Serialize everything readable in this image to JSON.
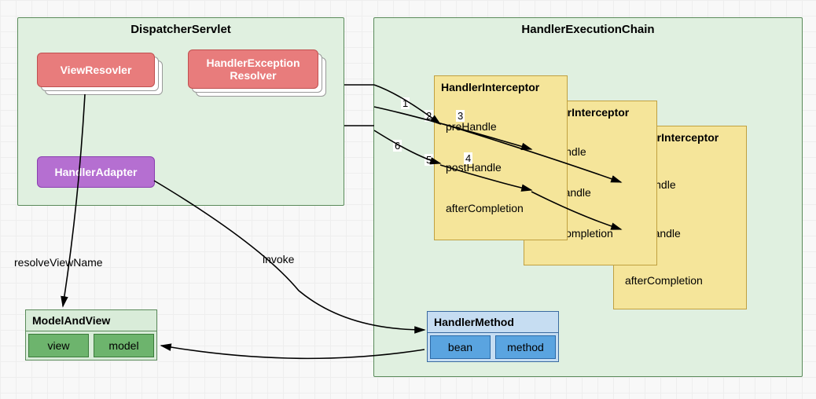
{
  "dispatcher": {
    "title": "DispatcherServlet",
    "viewResolver": "ViewResovler",
    "exceptionResolver": "HandlerException\nResolver",
    "handlerAdapter": "HandlerAdapter"
  },
  "chain": {
    "title": "HandlerExecutionChain",
    "interceptor": {
      "title": "HandlerInterceptor",
      "pre": "preHandle",
      "post": "postHandle",
      "after": "afterCompletion"
    }
  },
  "modelAndView": {
    "title": "ModelAndView",
    "view": "view",
    "model": "model"
  },
  "handlerMethod": {
    "title": "HandlerMethod",
    "bean": "bean",
    "method": "method"
  },
  "labels": {
    "resolveViewName": "resolveViewName",
    "invoke": "invoke"
  },
  "nums": {
    "n1": "1",
    "n2": "2",
    "n3": "3",
    "n4": "4",
    "n5": "5",
    "n6": "6"
  }
}
